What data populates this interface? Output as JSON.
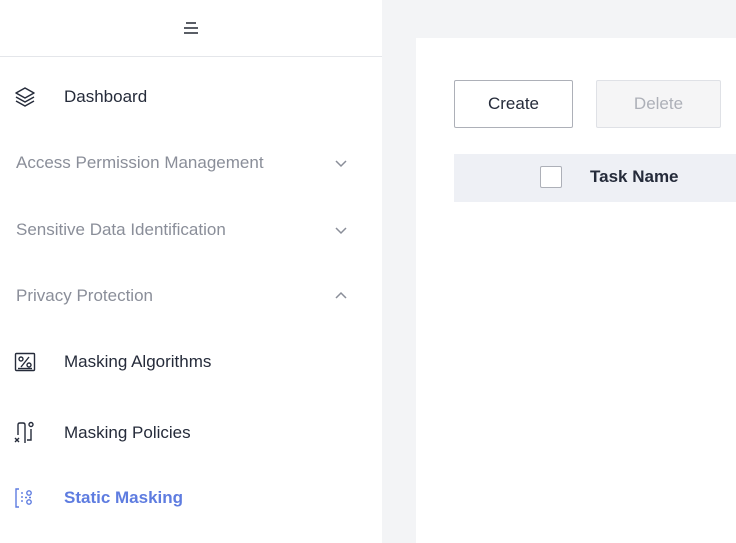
{
  "sidebar": {
    "dashboard_label": "Dashboard",
    "groups": {
      "access_permission": "Access Permission Management",
      "sensitive_data": "Sensitive Data Identification",
      "privacy_protection": "Privacy Protection"
    },
    "items": {
      "masking_algorithms": "Masking Algorithms",
      "masking_policies": "Masking Policies",
      "static_masking": "Static Masking"
    },
    "active_item": "Static Masking"
  },
  "toolbar": {
    "create_label": "Create",
    "delete_label": "Delete"
  },
  "table": {
    "columns": [
      "Task Name"
    ]
  },
  "colors": {
    "accent": "#5e7ce0",
    "sidebar_group_text": "#8a8e99",
    "main_background": "#f3f4f6",
    "table_header_background": "#eef0f5"
  },
  "icons": {
    "sidebar_toggle": "hamburger-icon",
    "dashboard": "layers-icon",
    "masking_algorithms": "percent-icon",
    "masking_policies": "policy-icon",
    "static_masking": "static-masking-icon"
  }
}
